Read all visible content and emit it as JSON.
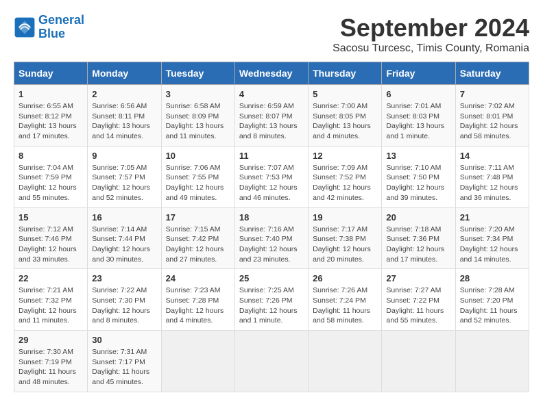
{
  "logo": {
    "line1": "General",
    "line2": "Blue"
  },
  "title": "September 2024",
  "subtitle": "Sacosu Turcesc, Timis County, Romania",
  "weekdays": [
    "Sunday",
    "Monday",
    "Tuesday",
    "Wednesday",
    "Thursday",
    "Friday",
    "Saturday"
  ],
  "weeks": [
    [
      {
        "day": "1",
        "info": "Sunrise: 6:55 AM\nSunset: 8:12 PM\nDaylight: 13 hours and 17 minutes."
      },
      {
        "day": "2",
        "info": "Sunrise: 6:56 AM\nSunset: 8:11 PM\nDaylight: 13 hours and 14 minutes."
      },
      {
        "day": "3",
        "info": "Sunrise: 6:58 AM\nSunset: 8:09 PM\nDaylight: 13 hours and 11 minutes."
      },
      {
        "day": "4",
        "info": "Sunrise: 6:59 AM\nSunset: 8:07 PM\nDaylight: 13 hours and 8 minutes."
      },
      {
        "day": "5",
        "info": "Sunrise: 7:00 AM\nSunset: 8:05 PM\nDaylight: 13 hours and 4 minutes."
      },
      {
        "day": "6",
        "info": "Sunrise: 7:01 AM\nSunset: 8:03 PM\nDaylight: 13 hours and 1 minute."
      },
      {
        "day": "7",
        "info": "Sunrise: 7:02 AM\nSunset: 8:01 PM\nDaylight: 12 hours and 58 minutes."
      }
    ],
    [
      {
        "day": "8",
        "info": "Sunrise: 7:04 AM\nSunset: 7:59 PM\nDaylight: 12 hours and 55 minutes."
      },
      {
        "day": "9",
        "info": "Sunrise: 7:05 AM\nSunset: 7:57 PM\nDaylight: 12 hours and 52 minutes."
      },
      {
        "day": "10",
        "info": "Sunrise: 7:06 AM\nSunset: 7:55 PM\nDaylight: 12 hours and 49 minutes."
      },
      {
        "day": "11",
        "info": "Sunrise: 7:07 AM\nSunset: 7:53 PM\nDaylight: 12 hours and 46 minutes."
      },
      {
        "day": "12",
        "info": "Sunrise: 7:09 AM\nSunset: 7:52 PM\nDaylight: 12 hours and 42 minutes."
      },
      {
        "day": "13",
        "info": "Sunrise: 7:10 AM\nSunset: 7:50 PM\nDaylight: 12 hours and 39 minutes."
      },
      {
        "day": "14",
        "info": "Sunrise: 7:11 AM\nSunset: 7:48 PM\nDaylight: 12 hours and 36 minutes."
      }
    ],
    [
      {
        "day": "15",
        "info": "Sunrise: 7:12 AM\nSunset: 7:46 PM\nDaylight: 12 hours and 33 minutes."
      },
      {
        "day": "16",
        "info": "Sunrise: 7:14 AM\nSunset: 7:44 PM\nDaylight: 12 hours and 30 minutes."
      },
      {
        "day": "17",
        "info": "Sunrise: 7:15 AM\nSunset: 7:42 PM\nDaylight: 12 hours and 27 minutes."
      },
      {
        "day": "18",
        "info": "Sunrise: 7:16 AM\nSunset: 7:40 PM\nDaylight: 12 hours and 23 minutes."
      },
      {
        "day": "19",
        "info": "Sunrise: 7:17 AM\nSunset: 7:38 PM\nDaylight: 12 hours and 20 minutes."
      },
      {
        "day": "20",
        "info": "Sunrise: 7:18 AM\nSunset: 7:36 PM\nDaylight: 12 hours and 17 minutes."
      },
      {
        "day": "21",
        "info": "Sunrise: 7:20 AM\nSunset: 7:34 PM\nDaylight: 12 hours and 14 minutes."
      }
    ],
    [
      {
        "day": "22",
        "info": "Sunrise: 7:21 AM\nSunset: 7:32 PM\nDaylight: 12 hours and 11 minutes."
      },
      {
        "day": "23",
        "info": "Sunrise: 7:22 AM\nSunset: 7:30 PM\nDaylight: 12 hours and 8 minutes."
      },
      {
        "day": "24",
        "info": "Sunrise: 7:23 AM\nSunset: 7:28 PM\nDaylight: 12 hours and 4 minutes."
      },
      {
        "day": "25",
        "info": "Sunrise: 7:25 AM\nSunset: 7:26 PM\nDaylight: 12 hours and 1 minute."
      },
      {
        "day": "26",
        "info": "Sunrise: 7:26 AM\nSunset: 7:24 PM\nDaylight: 11 hours and 58 minutes."
      },
      {
        "day": "27",
        "info": "Sunrise: 7:27 AM\nSunset: 7:22 PM\nDaylight: 11 hours and 55 minutes."
      },
      {
        "day": "28",
        "info": "Sunrise: 7:28 AM\nSunset: 7:20 PM\nDaylight: 11 hours and 52 minutes."
      }
    ],
    [
      {
        "day": "29",
        "info": "Sunrise: 7:30 AM\nSunset: 7:19 PM\nDaylight: 11 hours and 48 minutes."
      },
      {
        "day": "30",
        "info": "Sunrise: 7:31 AM\nSunset: 7:17 PM\nDaylight: 11 hours and 45 minutes."
      },
      {
        "day": "",
        "info": ""
      },
      {
        "day": "",
        "info": ""
      },
      {
        "day": "",
        "info": ""
      },
      {
        "day": "",
        "info": ""
      },
      {
        "day": "",
        "info": ""
      }
    ]
  ]
}
